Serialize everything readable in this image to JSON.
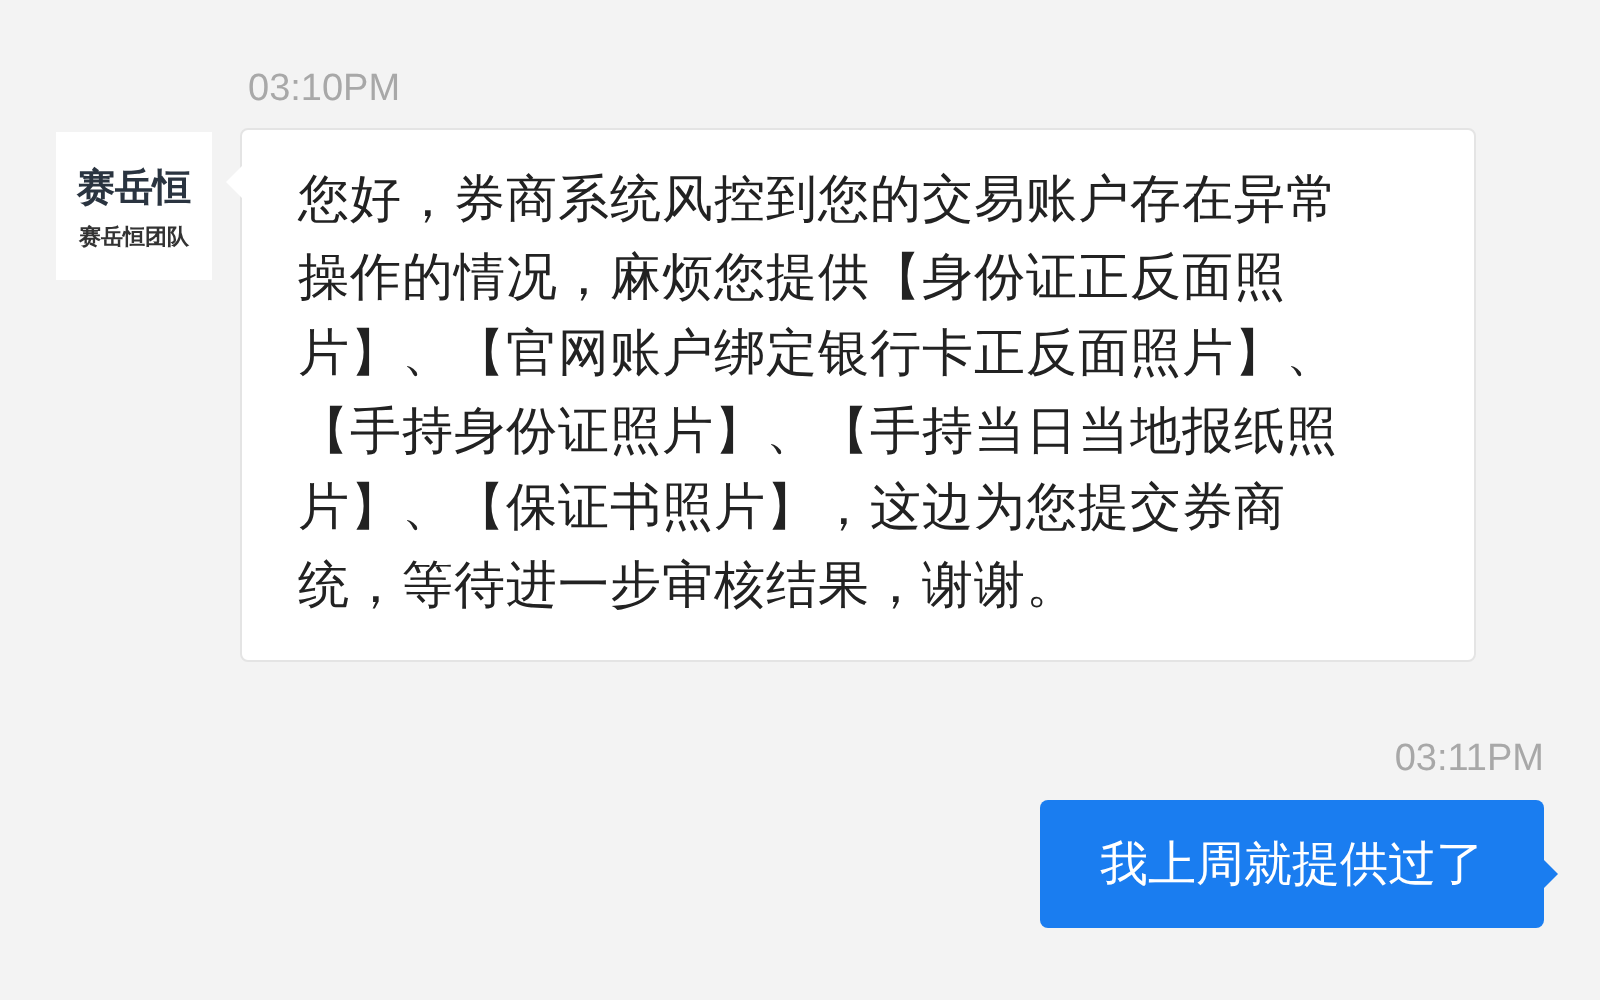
{
  "messages": [
    {
      "time": "03:10PM",
      "kind": "incoming",
      "avatar": {
        "logo": "赛岳恒",
        "caption": "赛岳恒团队"
      },
      "text": "您好，券商系统风控到您的交易账户存在异常操作的情况，麻烦您提供【身份证正反面照片】、【官网账户绑定银行卡正反面照片】、【手持身份证照片】、【手持当日当地报纸照片】、【保证书照片】，这边为您提交券商统，等待进一步审核结果，谢谢。"
    },
    {
      "time": "03:11PM",
      "kind": "outgoing",
      "text": "我上周就提供过了"
    }
  ]
}
